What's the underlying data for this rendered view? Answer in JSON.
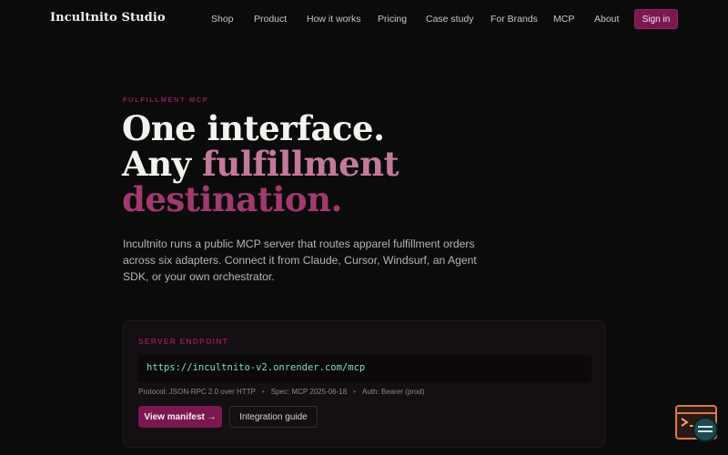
{
  "brand": "Incultnito Studio",
  "nav": {
    "items": [
      "Shop",
      "Product",
      "How it works",
      "Pricing",
      "Case study",
      "For Brands",
      "MCP",
      "About"
    ],
    "signin": "Sign in"
  },
  "hero": {
    "eyebrow": "FULFILLMENT MCP",
    "line1": "One interface.",
    "line2a": "Any ",
    "line2b": "fulfillment",
    "line3": "destination.",
    "lede": "Incultnito runs a public MCP server that routes apparel fulfillment orders across six adapters. Connect it from Claude, Cursor, Windsurf, an Agent SDK, or your own orchestrator."
  },
  "endpoint_card": {
    "label": "SERVER ENDPOINT",
    "url": "https://incultnito-v2.onrender.com/mcp",
    "meta": [
      "Protocol: JSON-RPC 2.0 over HTTP",
      "Spec: MCP 2025-06-18",
      "Auth: Bearer (prod)"
    ],
    "primary_button": "View manifest →",
    "secondary_button": "Integration guide"
  },
  "colors": {
    "accent": "#7c1850",
    "accent_text": "#8c1d55",
    "highlight": "#c27a9b",
    "endpoint_text": "#7fe0b3"
  },
  "widget_icon": "terminal-chat-icon"
}
